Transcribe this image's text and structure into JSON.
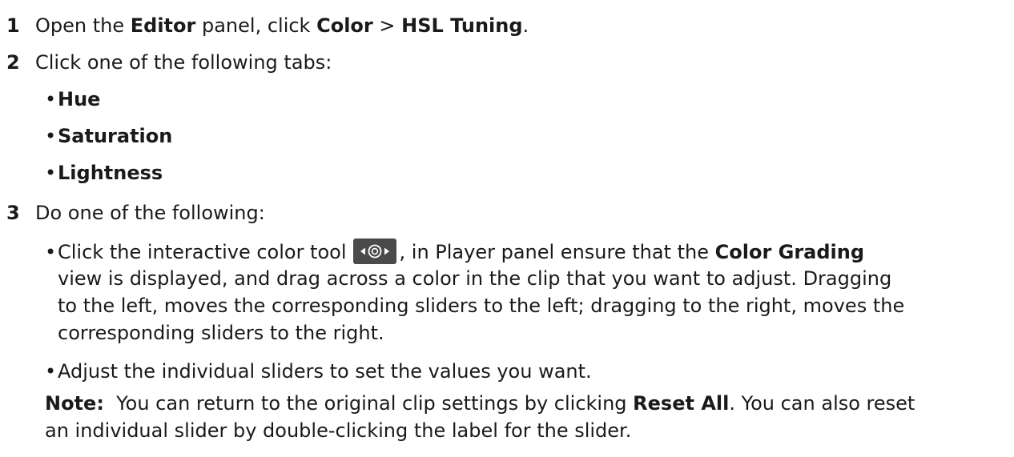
{
  "step1": {
    "num": "1",
    "pre": "Open the ",
    "editor": "Editor",
    "mid": " panel, click ",
    "color": "Color",
    "sep": " > ",
    "hsl": "HSL Tuning",
    "end": "."
  },
  "step2": {
    "num": "2",
    "text": "Click one of the following tabs:",
    "tabs": [
      "Hue",
      "Saturation",
      "Lightness"
    ]
  },
  "step3": {
    "num": "3",
    "text": "Do one of the following:",
    "bullet1": {
      "pre": "Click the interactive color tool",
      "post": ", in Player panel ensure that the ",
      "bold": "Color Grading",
      "line2": "view is displayed, and drag across a color in the clip that you want to adjust. Dragging",
      "line3": "to the left, moves the corresponding sliders to the left; dragging to the right, moves the",
      "line4": "corresponding sliders to the right."
    },
    "bullet2": "Adjust the individual sliders to set the values you want."
  },
  "note": {
    "label": "Note:",
    "pre": "  You can return to the original clip settings by clicking ",
    "bold": "Reset All",
    "post": ". You can also reset",
    "line2": "an individual slider by double-clicking the label for the slider."
  },
  "icons": {
    "tool": "interactive-color-tool-icon"
  }
}
